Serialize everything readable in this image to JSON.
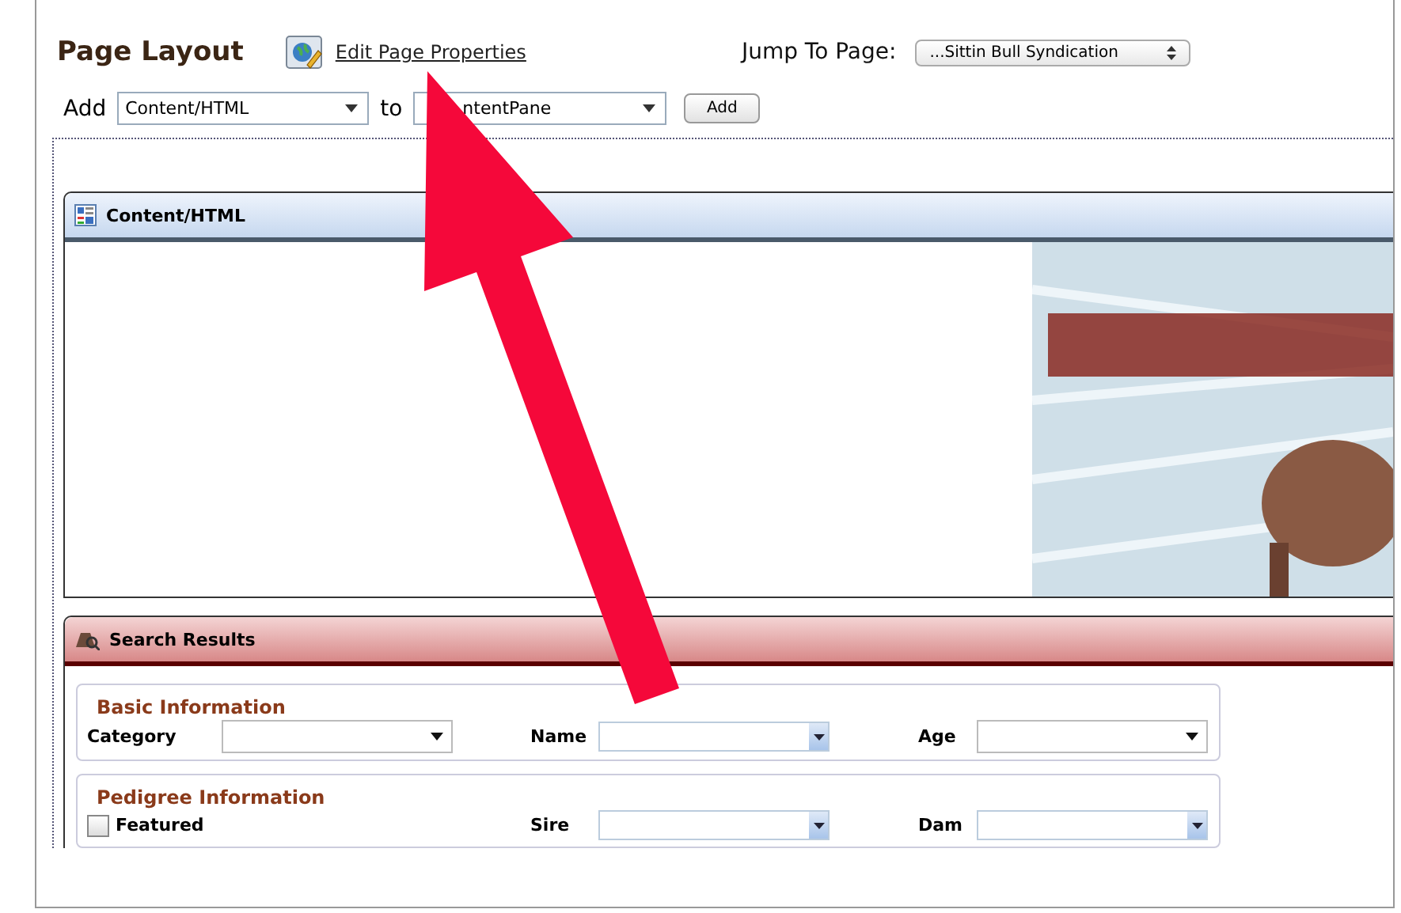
{
  "header": {
    "title": "Page Layout",
    "edit_link": "Edit Page Properties",
    "jump_label": "Jump To Page:",
    "jump_value": "...Sittin Bull Syndication"
  },
  "add_row": {
    "label": "Add",
    "module": "Content/HTML",
    "to_label": "to",
    "pane": "ntentPane",
    "button": "Add"
  },
  "modules": [
    {
      "kind": "content",
      "title": "Content/HTML"
    },
    {
      "kind": "search",
      "title": "Search Results",
      "groups": [
        {
          "legend": "Basic Information",
          "fields": [
            {
              "kind": "select",
              "label": "Category"
            },
            {
              "kind": "combo",
              "label": "Name"
            },
            {
              "kind": "select",
              "label": "Age"
            }
          ]
        },
        {
          "legend": "Pedigree Information",
          "fields": [
            {
              "kind": "checkbox",
              "label": "Featured",
              "checked": false
            },
            {
              "kind": "combo",
              "label": "Sire"
            },
            {
              "kind": "combo",
              "label": "Dam"
            }
          ]
        }
      ]
    }
  ]
}
